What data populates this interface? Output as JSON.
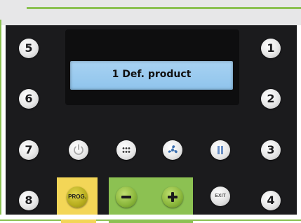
{
  "display": {
    "text": "1 Def. product"
  },
  "number_buttons": {
    "b1": "1",
    "b2": "2",
    "b3": "3",
    "b4": "4",
    "b5": "5",
    "b6": "6",
    "b7": "7",
    "b8": "8"
  },
  "function_buttons": {
    "prog_label": "PROG.",
    "exit_label": "EXIT",
    "icons": [
      "power-icon",
      "dots-grid-icon",
      "fan-icon",
      "pause-icon",
      "minus-icon",
      "plus-icon"
    ]
  },
  "colors": {
    "panel": "#1b1b1d",
    "lcd": "#9ccbef",
    "prog_highlight": "#f3d657",
    "plusminus_highlight": "#8cc152",
    "accent_line": "#8cc152"
  }
}
